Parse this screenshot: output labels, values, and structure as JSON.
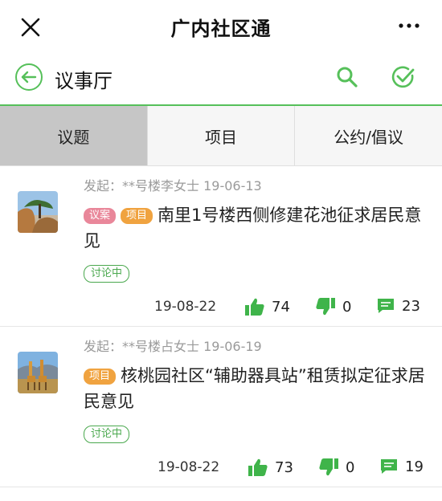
{
  "header": {
    "title": "广内社区通"
  },
  "subheader": {
    "title": "议事厅"
  },
  "tabs": [
    {
      "label": "议题"
    },
    {
      "label": "项目"
    },
    {
      "label": "公约/倡议"
    }
  ],
  "colors": {
    "accent": "#56c05a",
    "tag_yian": "#e9879a",
    "tag_xiangmu": "#f0a340"
  },
  "items": [
    {
      "initiator": "发起：**号楼李女士 19-06-13",
      "tags": [
        "议案",
        "项目"
      ],
      "title": "南里1号楼西侧修建花池征求居民意见",
      "status": "讨论中",
      "date": "19-08-22",
      "likes": "74",
      "dislikes": "0",
      "comments": "23",
      "avatar_icon": "rock-tree-photo"
    },
    {
      "initiator": "发起：**号楼占女士 19-06-19",
      "tags": [
        "项目"
      ],
      "title": "核桃园社区“辅助器具站”租赁拟定征求居民意见",
      "status": "讨论中",
      "date": "19-08-22",
      "likes": "73",
      "dislikes": "0",
      "comments": "19",
      "avatar_icon": "giraffes-photo"
    }
  ]
}
